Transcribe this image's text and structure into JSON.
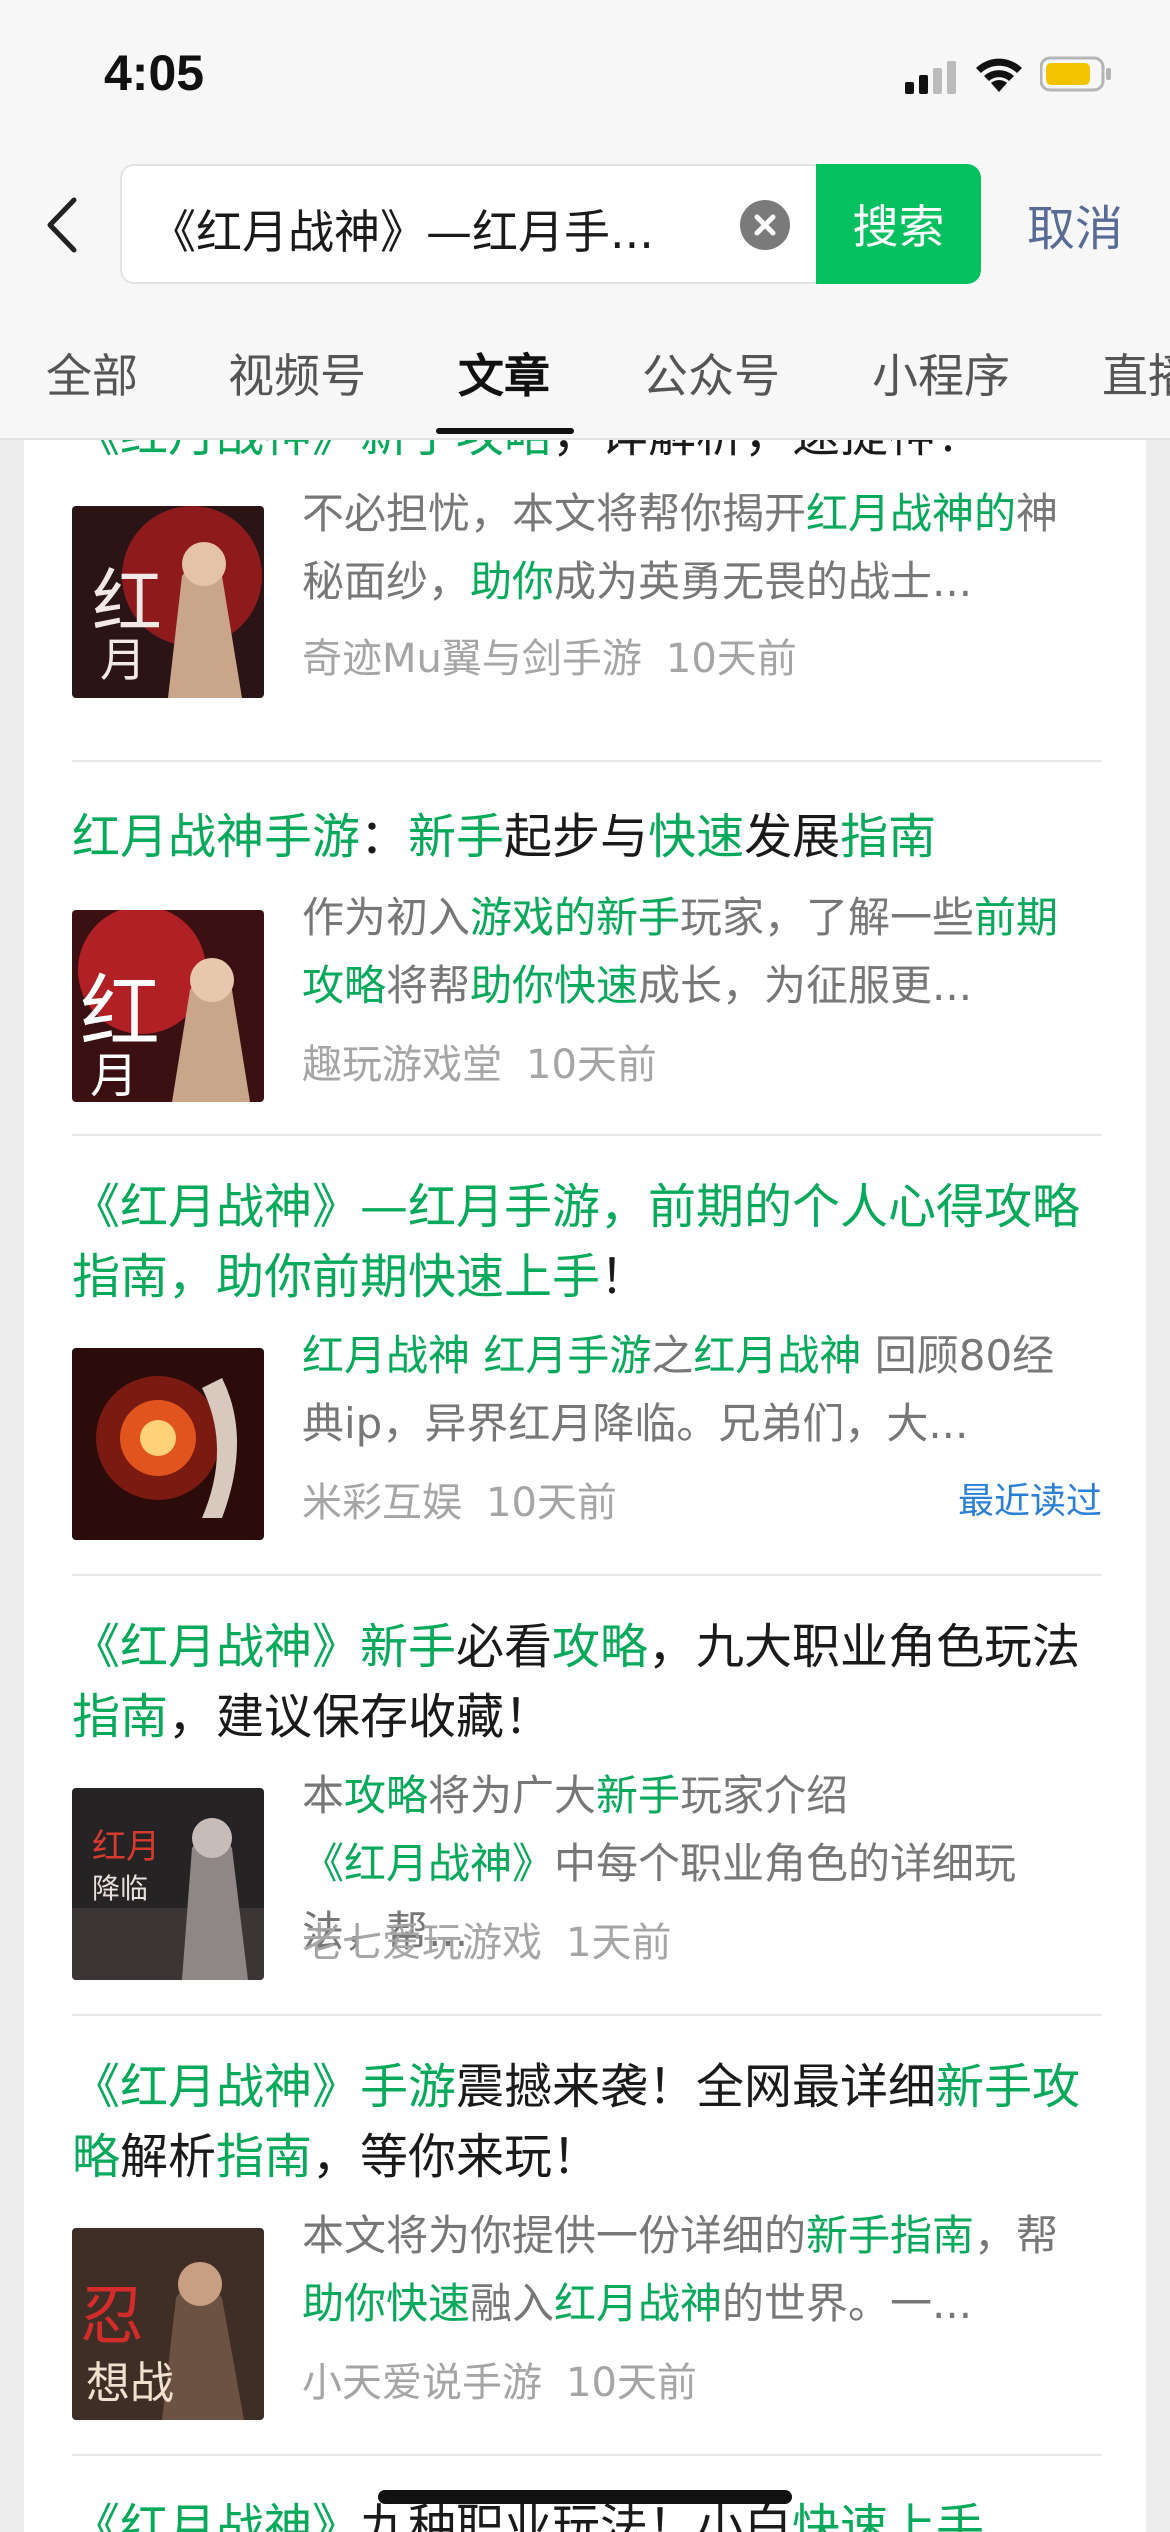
{
  "status_bar": {
    "time": "4:05"
  },
  "search": {
    "query": "《红月战神》—红月手...",
    "button_label": "搜索",
    "cancel_label": "取消"
  },
  "tabs": [
    "全部",
    "视频号",
    "文章",
    "公众号",
    "小程序",
    "直播"
  ],
  "active_tab": "文章",
  "colors": {
    "accent_green": "#07c160",
    "highlight_green": "#07a95a",
    "link_blue": "#2a7fd6",
    "cancel_blue": "#576b95"
  },
  "articles": [
    {
      "title_parts": [
        {
          "text": "《红月战神》新手攻略",
          "hl": true
        },
        {
          "text": "，详解析，速提神！",
          "hl": false
        }
      ],
      "excerpt_parts": [
        {
          "text": "不必担忧，本文将帮你揭开",
          "hl": false
        },
        {
          "text": "红月战神的",
          "hl": true
        },
        {
          "text": "神秘面纱，",
          "hl": false
        },
        {
          "text": "助你",
          "hl": true
        },
        {
          "text": "成为英勇无畏的战士...",
          "hl": false
        }
      ],
      "source": "奇迹Mu翼与剑手游",
      "time": "10天前",
      "thumb_icon": "game-poster-red-moon-warrior"
    },
    {
      "title_parts": [
        {
          "text": "红月战神手游",
          "hl": true
        },
        {
          "text": "：",
          "hl": false
        },
        {
          "text": "新手",
          "hl": true
        },
        {
          "text": "起步与",
          "hl": false
        },
        {
          "text": "快速",
          "hl": true
        },
        {
          "text": "发展",
          "hl": false
        },
        {
          "text": "指南",
          "hl": true
        }
      ],
      "excerpt_parts": [
        {
          "text": "作为初入",
          "hl": false
        },
        {
          "text": "游戏的新手",
          "hl": true
        },
        {
          "text": "玩家，了解一些",
          "hl": false
        },
        {
          "text": "前期攻略",
          "hl": true
        },
        {
          "text": "将帮",
          "hl": false
        },
        {
          "text": "助你快速",
          "hl": true
        },
        {
          "text": "成长，为征服更...",
          "hl": false
        }
      ],
      "source": "趣玩游戏堂",
      "time": "10天前",
      "thumb_icon": "game-poster-red-moon-warrior"
    },
    {
      "title_parts": [
        {
          "text": "《红月战神》—红月手游，前期的个人心得攻略指南，助你前期快速上手",
          "hl": true
        },
        {
          "text": "！",
          "hl": false
        }
      ],
      "excerpt_parts": [
        {
          "text": "红月战神 红月手游",
          "hl": true
        },
        {
          "text": "之",
          "hl": false
        },
        {
          "text": "红月战神",
          "hl": true
        },
        {
          "text": " 回顾80经典ip，异界红月降临。兄弟们，大...",
          "hl": false
        }
      ],
      "source": "米彩互娱",
      "time": "10天前",
      "recent": "最近读过",
      "thumb_icon": "game-poster-orb"
    },
    {
      "title_parts": [
        {
          "text": "《红月战神》新手",
          "hl": true
        },
        {
          "text": "必看",
          "hl": false
        },
        {
          "text": "攻略",
          "hl": true
        },
        {
          "text": "，九大职业角色玩法",
          "hl": false
        },
        {
          "text": "指南",
          "hl": true
        },
        {
          "text": "，建议保存收藏！",
          "hl": false
        }
      ],
      "excerpt_parts": [
        {
          "text": "本",
          "hl": false
        },
        {
          "text": "攻略",
          "hl": true
        },
        {
          "text": "将为广大",
          "hl": false
        },
        {
          "text": "新手",
          "hl": true
        },
        {
          "text": "玩家介绍",
          "hl": false
        },
        {
          "text": "《红月战神》",
          "hl": true
        },
        {
          "text": "中每个职业角色的详细玩法，帮...",
          "hl": false
        }
      ],
      "source": "老七爱玩游戏",
      "time": "1天前",
      "thumb_icon": "game-poster-dark-warrior"
    },
    {
      "title_parts": [
        {
          "text": "《红月战神》手游",
          "hl": true
        },
        {
          "text": "震撼来袭！全网最详细",
          "hl": false
        },
        {
          "text": "新手攻略",
          "hl": true
        },
        {
          "text": "解析",
          "hl": false
        },
        {
          "text": "指南",
          "hl": true
        },
        {
          "text": "，等你来玩！",
          "hl": false
        }
      ],
      "excerpt_parts": [
        {
          "text": "本文将为你提供一份详细的",
          "hl": false
        },
        {
          "text": "新手指南",
          "hl": true
        },
        {
          "text": "，帮",
          "hl": false
        },
        {
          "text": "助你快速",
          "hl": true
        },
        {
          "text": "融入",
          "hl": false
        },
        {
          "text": "红月战神",
          "hl": true
        },
        {
          "text": "的世界。一...",
          "hl": false
        }
      ],
      "source": "小天爱说手游",
      "time": "10天前",
      "thumb_icon": "game-poster-armored-hero"
    },
    {
      "title_parts": [
        {
          "text": "《红月战神》",
          "hl": true
        },
        {
          "text": "九种职业玩法！小白",
          "hl": false
        },
        {
          "text": "快速上手",
          "hl": true
        }
      ],
      "excerpt_parts": [],
      "source": "",
      "time": "",
      "thumb_icon": ""
    }
  ]
}
